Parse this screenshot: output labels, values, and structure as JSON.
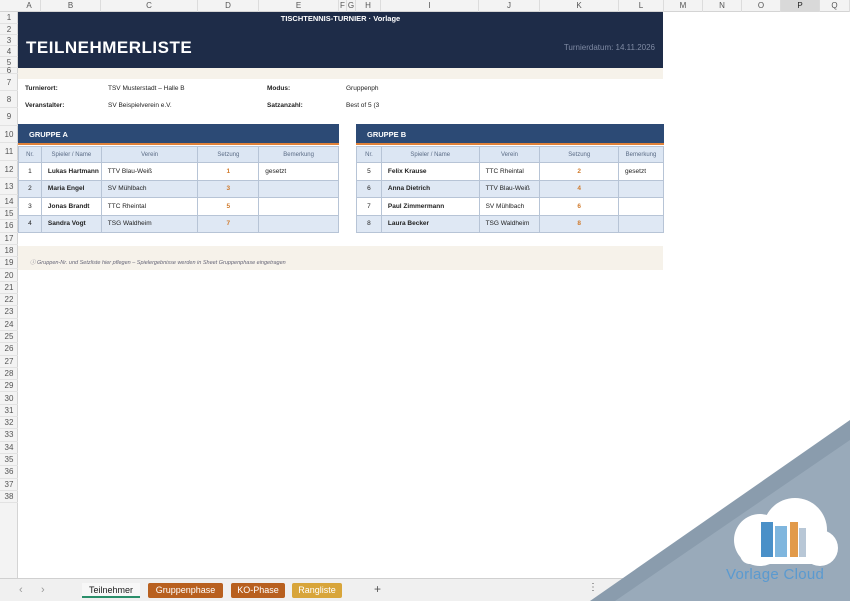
{
  "columns": [
    "A",
    "B",
    "C",
    "D",
    "E",
    "F",
    "G",
    "H",
    "I",
    "J",
    "K",
    "L",
    "M",
    "N",
    "O",
    "P",
    "Q"
  ],
  "selected_column": "P",
  "rows": [
    "1",
    "2",
    "3",
    "4",
    "5",
    "6",
    "7",
    "8",
    "9",
    "10",
    "11",
    "12",
    "13",
    "14",
    "15",
    "16",
    "17",
    "18",
    "19",
    "20",
    "21",
    "22",
    "23",
    "24",
    "25",
    "26",
    "27",
    "28",
    "29",
    "30",
    "31",
    "32",
    "33",
    "34",
    "35",
    "36",
    "37",
    "38"
  ],
  "banner": {
    "top": "TISCHTENNIS-TURNIER  ·  Vorlage",
    "title": "TEILNEHMERLISTE",
    "date": "Turnierdatum: 14.11.2026"
  },
  "info": {
    "ort_label": "Turnierort:",
    "ort_value": "TSV Musterstadt – Halle B",
    "modus_label": "Modus:",
    "modus_value": "Gruppenph",
    "veranstalter_label": "Veranstalter:",
    "veranstalter_value": "SV Beispielverein e.V.",
    "satz_label": "Satzanzahl:",
    "satz_value": "Best of 5 (3"
  },
  "headers": [
    "Nr.",
    "Spieler / Name",
    "Verein",
    "Setzung",
    "Bemerkung"
  ],
  "group_a": {
    "title": "GRUPPE A",
    "rows": [
      {
        "nr": "1",
        "name": "Lukas Hartmann",
        "verein": "TTV Blau-Weiß",
        "setzung": "1",
        "bemerkung": "gesetzt"
      },
      {
        "nr": "2",
        "name": "Maria Engel",
        "verein": "SV Mühlbach",
        "setzung": "3",
        "bemerkung": ""
      },
      {
        "nr": "3",
        "name": "Jonas Brandt",
        "verein": "TTC Rheintal",
        "setzung": "5",
        "bemerkung": ""
      },
      {
        "nr": "4",
        "name": "Sandra Vogt",
        "verein": "TSG Waldheim",
        "setzung": "7",
        "bemerkung": ""
      }
    ]
  },
  "group_b": {
    "title": "GRUPPE B",
    "rows": [
      {
        "nr": "5",
        "name": "Felix Krause",
        "verein": "TTC Rheintal",
        "setzung": "2",
        "bemerkung": "gesetzt"
      },
      {
        "nr": "6",
        "name": "Anna Dietrich",
        "verein": "TTV Blau-Weiß",
        "setzung": "4",
        "bemerkung": ""
      },
      {
        "nr": "7",
        "name": "Paul Zimmermann",
        "verein": "SV Mühlbach",
        "setzung": "6",
        "bemerkung": ""
      },
      {
        "nr": "8",
        "name": "Laura Becker",
        "verein": "TSG Waldheim",
        "setzung": "8",
        "bemerkung": ""
      }
    ]
  },
  "note": "ⓘ Gruppen-Nr. und Setzliste hier pflegen – Spielergebnisse werden in Sheet Gruppenphase eingetragen",
  "tabs": [
    {
      "label": "Teilnehmer",
      "color": "#f7f7f7",
      "active": true
    },
    {
      "label": "Gruppenphase",
      "color": "#b8601f"
    },
    {
      "label": "KO-Phase",
      "color": "#b8601f"
    },
    {
      "label": "Rangliste",
      "color": "#d8a53a"
    }
  ],
  "add_sheet": "+",
  "more_menu": "⋮",
  "nav_prev": "‹",
  "nav_next": "›",
  "watermark": "Vorlage Cloud",
  "colors": {
    "banner": "#1e2c48",
    "group_header": "#2c4a75",
    "accent": "#e0823a",
    "seed": "#d07a2c"
  }
}
